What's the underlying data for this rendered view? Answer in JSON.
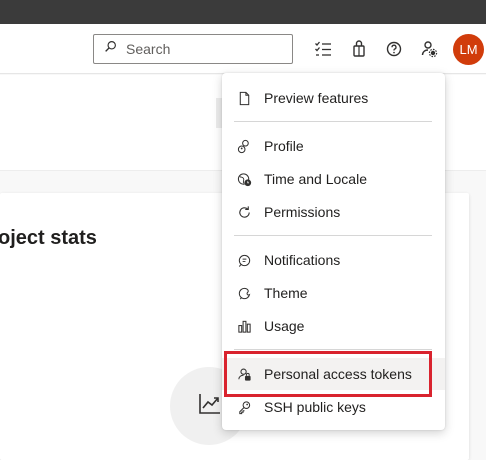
{
  "header": {
    "search": {
      "placeholder": "Search",
      "value": ""
    },
    "icons": [
      "search-icon",
      "task-list-icon",
      "shopping-bag-icon",
      "help-icon",
      "user-settings-icon"
    ],
    "avatar_initials": "LM",
    "avatar_color": "#d13c0b"
  },
  "main": {
    "card_title": "oject stats"
  },
  "menu": {
    "items": [
      {
        "label": "Preview features",
        "icon": "document-icon"
      },
      {
        "label": "Profile",
        "icon": "profile-icon"
      },
      {
        "label": "Time and Locale",
        "icon": "globe-clock-icon"
      },
      {
        "label": "Permissions",
        "icon": "refresh-icon"
      },
      {
        "label": "Notifications",
        "icon": "notification-icon"
      },
      {
        "label": "Theme",
        "icon": "theme-icon"
      },
      {
        "label": "Usage",
        "icon": "usage-chart-icon"
      },
      {
        "label": "Personal access tokens",
        "icon": "token-icon"
      },
      {
        "label": "SSH public keys",
        "icon": "key-icon"
      }
    ]
  },
  "colors": {
    "highlight": "#d9232e",
    "titlebar": "#3b3b3b"
  }
}
